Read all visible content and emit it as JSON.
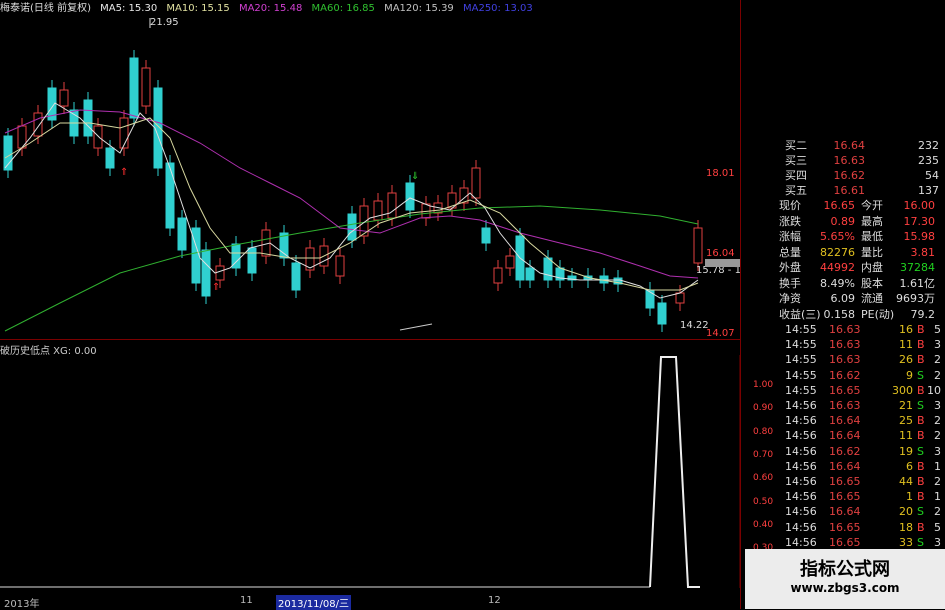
{
  "topbar": {
    "title": "梅泰诺(日线 前复权)",
    "ma5": "MA5: 15.30",
    "ma10": "MA10: 15.15",
    "ma20": "MA20: 15.48",
    "ma60": "MA60: 16.85",
    "ma120": "MA120: 15.39",
    "ma250": "MA250: 13.03",
    "colors": {
      "ma5": "#e8e8e8",
      "ma10": "#e0e0a0",
      "ma20": "#d040d0",
      "ma60": "#30c030",
      "ma120": "#c0c0c0",
      "ma250": "#4040e0"
    }
  },
  "price_axis": {
    "high": "18.01",
    "mid": "16.04",
    "low": "14.07"
  },
  "annotations": {
    "peak": "21.95",
    "low": "14.22",
    "right": "15.78 - 15."
  },
  "indicator": {
    "header": "破历史低点 XG: 0.00",
    "ticks": [
      "1.00",
      "0.90",
      "0.80",
      "0.70",
      "0.60",
      "0.50",
      "0.40",
      "0.30",
      "0.20",
      "0.10"
    ]
  },
  "xaxis": {
    "year": "2013年",
    "m11": "11",
    "selected": "2013/11/08/三",
    "m12": "12"
  },
  "orderbook": [
    {
      "label": "买二",
      "price": "16.64",
      "vol": "232"
    },
    {
      "label": "买三",
      "price": "16.63",
      "vol": "235"
    },
    {
      "label": "买四",
      "price": "16.62",
      "vol": "54"
    },
    {
      "label": "买五",
      "price": "16.61",
      "vol": "137"
    }
  ],
  "quote": [
    {
      "k1": "现价",
      "v1": "16.65",
      "c1": "red",
      "k2": "今开",
      "v2": "16.00",
      "c2": "red"
    },
    {
      "k1": "涨跌",
      "v1": "0.89",
      "c1": "red",
      "k2": "最高",
      "v2": "17.30",
      "c2": "red"
    },
    {
      "k1": "涨幅",
      "v1": "5.65%",
      "c1": "red",
      "k2": "最低",
      "v2": "15.98",
      "c2": "red"
    },
    {
      "k1": "总量",
      "v1": "82276",
      "c1": "yel",
      "k2": "量比",
      "v2": "3.81",
      "c2": "red"
    },
    {
      "k1": "外盘",
      "v1": "44992",
      "c1": "red",
      "k2": "内盘",
      "v2": "37284",
      "c2": "grn"
    },
    {
      "k1": "换手",
      "v1": "8.49%",
      "c1": "w",
      "k2": "股本",
      "v2": "1.61亿",
      "c2": "w"
    },
    {
      "k1": "净资",
      "v1": "6.09",
      "c1": "w",
      "k2": "流通",
      "v2": "9693万",
      "c2": "w"
    },
    {
      "k1": "收益(三)",
      "v1": "0.158",
      "c1": "w",
      "k2": "PE(动)",
      "v2": "79.2",
      "c2": "w"
    }
  ],
  "trades": [
    {
      "t": "14:55",
      "p": "16.63",
      "v": "16",
      "bs": "B",
      "n": "5"
    },
    {
      "t": "14:55",
      "p": "16.63",
      "v": "11",
      "bs": "B",
      "n": "3"
    },
    {
      "t": "14:55",
      "p": "16.63",
      "v": "26",
      "bs": "B",
      "n": "2"
    },
    {
      "t": "14:55",
      "p": "16.62",
      "v": "9",
      "bs": "S",
      "n": "2"
    },
    {
      "t": "14:55",
      "p": "16.65",
      "v": "300",
      "bs": "B",
      "n": "10"
    },
    {
      "t": "14:56",
      "p": "16.63",
      "v": "21",
      "bs": "S",
      "n": "3"
    },
    {
      "t": "14:56",
      "p": "16.64",
      "v": "25",
      "bs": "B",
      "n": "2"
    },
    {
      "t": "14:56",
      "p": "16.64",
      "v": "11",
      "bs": "B",
      "n": "2"
    },
    {
      "t": "14:56",
      "p": "16.62",
      "v": "19",
      "bs": "S",
      "n": "3"
    },
    {
      "t": "14:56",
      "p": "16.64",
      "v": "6",
      "bs": "B",
      "n": "1"
    },
    {
      "t": "14:56",
      "p": "16.65",
      "v": "44",
      "bs": "B",
      "n": "2"
    },
    {
      "t": "14:56",
      "p": "16.65",
      "v": "1",
      "bs": "B",
      "n": "1"
    },
    {
      "t": "14:56",
      "p": "16.64",
      "v": "20",
      "bs": "S",
      "n": "2"
    },
    {
      "t": "14:56",
      "p": "16.65",
      "v": "18",
      "bs": "B",
      "n": "5"
    },
    {
      "t": "14:56",
      "p": "16.65",
      "v": "33",
      "bs": "S",
      "n": "3"
    },
    {
      "t": "14:56",
      "p": "16.64",
      "v": "10",
      "bs": "B",
      "n": "2"
    }
  ],
  "watermark": {
    "title": "指标公式网",
    "url": "www.zbgs3.com"
  }
}
